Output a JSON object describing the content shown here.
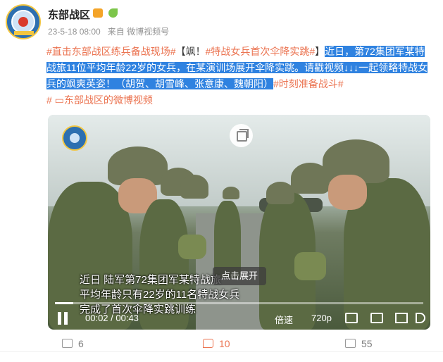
{
  "header": {
    "name": "东部战区",
    "date": "23-5-18 08:00",
    "source": "来自 微博视频号"
  },
  "post": {
    "topic1": "#直击东部战区练兵备战现场#",
    "text1": "【飒！",
    "topic2": "#特战女兵首次伞降实跳#",
    "text2": "】",
    "highlight": "近日，第72集团军某特战旅11位平均年龄22岁的女兵，在某演训场展开伞降实跳。请戳视频↓↓↓一起领略特战女兵的飒爽英姿！（胡贺、胡雪峰、张意康、魏朝阳）",
    "topic3": "#时刻准备战斗#",
    "video_link": "东部战区的微博视频"
  },
  "video": {
    "caption_line1": "近日 陆军第72集团军某特战旅",
    "caption_line2": "平均年龄只有22岁的11名特战女兵",
    "caption_line3": "完成了首次伞降实跳训练",
    "expand_label": "点击展开",
    "time": "00:02 / 00:43",
    "speed": "倍速",
    "quality": "720p",
    "progress": 0.05
  },
  "actions": {
    "share_count": "6",
    "comment_count": "10",
    "like_count": "55"
  },
  "icons": {
    "avatar": "military-emblem",
    "pip": "picture-in-picture-icon",
    "play": "pause-icon"
  },
  "colors": {
    "topic_link": "#eb7350",
    "highlight_bg": "#2f82e0"
  }
}
